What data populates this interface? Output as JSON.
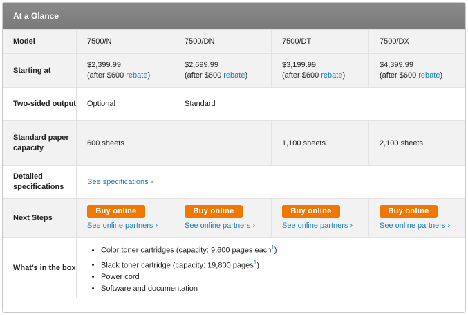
{
  "title": "At a Glance",
  "rows": {
    "model": {
      "label": "Model",
      "values": [
        "7500/N",
        "7500/DN",
        "7500/DT",
        "7500/DX"
      ]
    },
    "starting": {
      "label": "Starting at",
      "prices": [
        "$2,399.99",
        "$2,699.99",
        "$3,199.99",
        "$4,399.99"
      ],
      "after_prefix": "(after $600 ",
      "rebate_link": "rebate",
      "after_suffix": ")"
    },
    "two_sided": {
      "label": "Two-sided output",
      "optional": "Optional",
      "standard": "Standard"
    },
    "paper": {
      "label": "Standard paper capacity",
      "values": [
        "600 sheets",
        "1,100 sheets",
        "2,100 sheets"
      ]
    },
    "specs": {
      "label": "Detailed specifications",
      "link": "See specifications ›"
    },
    "next": {
      "label": "Next Steps",
      "buy": "Buy online",
      "partners": "See online partners ›"
    },
    "box": {
      "label": "What's in the box",
      "items": [
        {
          "text": "Color toner cartridges (capacity: 9,600 pages each",
          "sup": "1",
          "end": ")"
        },
        {
          "text": "Black toner cartridge (capacity: 19,800 pages",
          "sup": "1",
          "end": ")"
        },
        {
          "text": "Power cord",
          "sup": "",
          "end": ""
        },
        {
          "text": "Software and documentation",
          "sup": "",
          "end": ""
        }
      ]
    }
  },
  "colors": {
    "header_bg": "#7f7f7f",
    "button": "#f07800",
    "link": "#1a80b6"
  }
}
